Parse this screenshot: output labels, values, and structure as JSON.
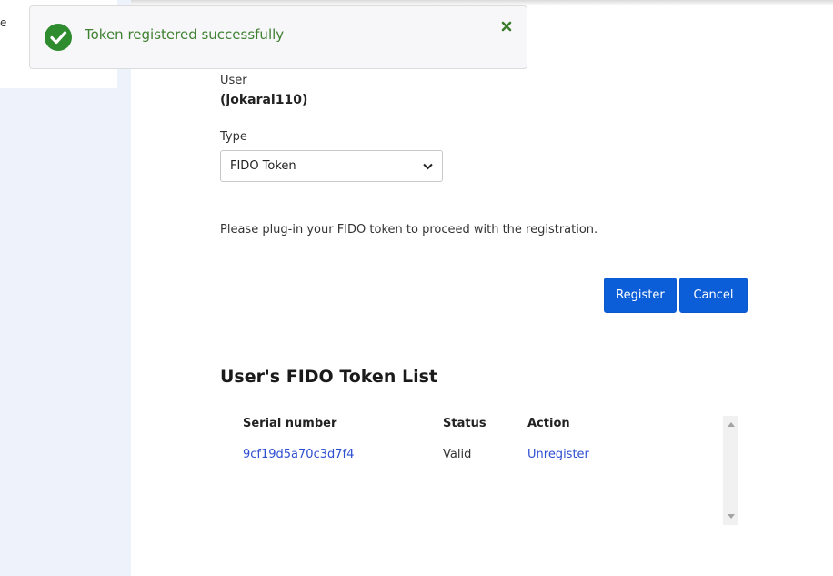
{
  "sidebar": {
    "fragment_text": "e"
  },
  "toast": {
    "message": "Token registered successfully",
    "icon": "check-circle-icon",
    "close_icon": "close-icon",
    "color": "#3f8132"
  },
  "form": {
    "user_label": "User",
    "user_value": "(jokaral110)",
    "type_label": "Type",
    "type_selected": "FIDO Token",
    "instruction": "Please plug-in your FIDO token to proceed with the registration."
  },
  "actions": {
    "register_label": "Register",
    "cancel_label": "Cancel",
    "button_color": "#0b5ed7"
  },
  "token_list": {
    "title": "User's FIDO Token List",
    "columns": [
      "Serial number",
      "Status",
      "Action"
    ],
    "rows": [
      {
        "serial": "9cf19d5a70c3d7f4",
        "status": "Valid",
        "action": "Unregister"
      }
    ]
  }
}
